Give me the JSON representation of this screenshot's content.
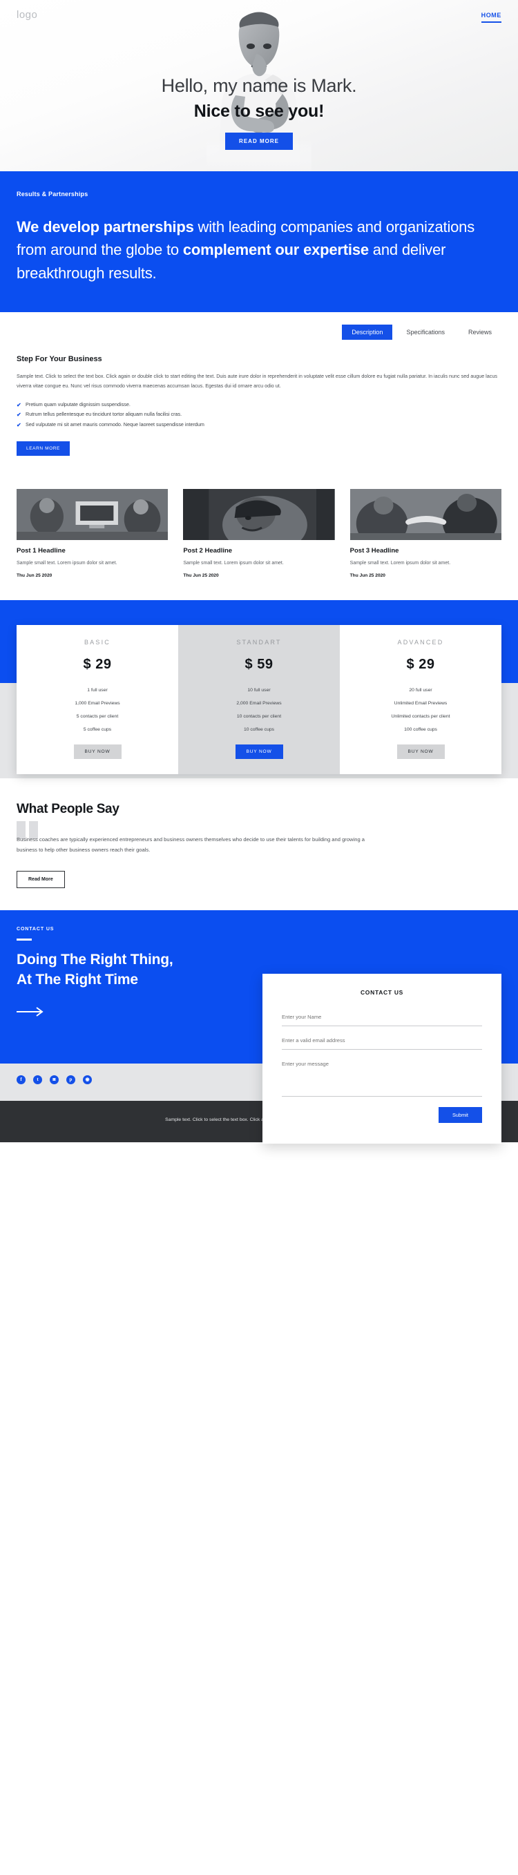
{
  "header": {
    "logo": "logo",
    "nav": [
      {
        "label": "HOME"
      }
    ]
  },
  "hero": {
    "line1": "Hello, my name is Mark.",
    "line2": "Nice to see you!",
    "cta": "READ MORE"
  },
  "partnership": {
    "eyebrow": "Results & Partnerships",
    "part1": "We develop partnerships",
    "part2": " with leading companies and organizations from around the globe to ",
    "part3": "complement our expertise",
    "part4": " and deliver breakthrough results."
  },
  "description": {
    "tabs": [
      {
        "label": "Description",
        "active": true
      },
      {
        "label": "Specifications",
        "active": false
      },
      {
        "label": "Reviews",
        "active": false
      }
    ],
    "title": "Step For Your Business",
    "paragraph": "Sample text. Click to select the text box. Click again or double click to start editing the text. Duis aute irure dolor in reprehenderit in voluptate velit esse cillum dolore eu fugiat nulla pariatur. In iaculis nunc sed augue lacus viverra vitae congue eu. Nunc vel risus commodo viverra maecenas accumsan lacus. Egestas dui id ornare arcu odio ut.",
    "features": [
      "Pretium quam vulputate dignissim suspendisse.",
      "Rutrum tellus pellentesque eu tincidunt tortor aliquam nulla facilisi cras.",
      "Sed vulputate mi sit amet mauris commodo. Neque laoreet suspendisse interdum"
    ],
    "cta": "LEARN MORE"
  },
  "posts": [
    {
      "title": "Post 1 Headline",
      "text": "Sample small text. Lorem ipsum dolor sit amet.",
      "date": "Thu Jun 25 2020"
    },
    {
      "title": "Post 2 Headline",
      "text": "Sample small text. Lorem ipsum dolor sit amet.",
      "date": "Thu Jun 25 2020"
    },
    {
      "title": "Post 3 Headline",
      "text": "Sample small text. Lorem ipsum dolor sit amet.",
      "date": "Thu Jun 25 2020"
    }
  ],
  "pricing": [
    {
      "name": "BASIC",
      "price": "$ 29",
      "features": [
        "1 full user",
        "1,000 Email Previews",
        "5 contacts per client",
        "5 coffee cups"
      ],
      "cta": "BUY NOW",
      "featured": false
    },
    {
      "name": "STANDART",
      "price": "$ 59",
      "features": [
        "10 full user",
        "2,000 Email Previews",
        "10 contacts per client",
        "10 coffee cups"
      ],
      "cta": "BUY NOW",
      "featured": true
    },
    {
      "name": "ADVANCED",
      "price": "$ 29",
      "features": [
        "20 full user",
        "Unlimited Email Previews",
        "Unlimited contacts per client",
        "100 coffee cups"
      ],
      "cta": "BUY NOW",
      "featured": false
    }
  ],
  "testimonial": {
    "title": "What People Say",
    "text": "Business coaches are typically experienced entrepreneurs and business owners themselves who decide to use their talents for building and growing a business to help other business owners reach their goals.",
    "cta": "Read More"
  },
  "contact": {
    "eyebrow": "CONTACT US",
    "headline": "Doing The Right Thing, At The Right Time",
    "form": {
      "title": "CONTACT US",
      "name_placeholder": "Enter your Name",
      "email_placeholder": "Enter a valid email address",
      "message_placeholder": "Enter your message",
      "submit": "Submit"
    }
  },
  "social": [
    {
      "name": "facebook-icon",
      "glyph": "f"
    },
    {
      "name": "twitter-icon",
      "glyph": "t"
    },
    {
      "name": "instagram-icon",
      "glyph": "◙"
    },
    {
      "name": "pinterest-icon",
      "glyph": "p"
    },
    {
      "name": "dribbble-icon",
      "glyph": "◉"
    }
  ],
  "footer": {
    "text": "Sample text. Click to select the text box. Click again or double click to start editing the text."
  },
  "colors": {
    "brand_blue": "#0b4ef0",
    "button_blue": "#1450e8",
    "grey_bg": "#e4e5e7",
    "footer_dark": "#2f3134"
  }
}
